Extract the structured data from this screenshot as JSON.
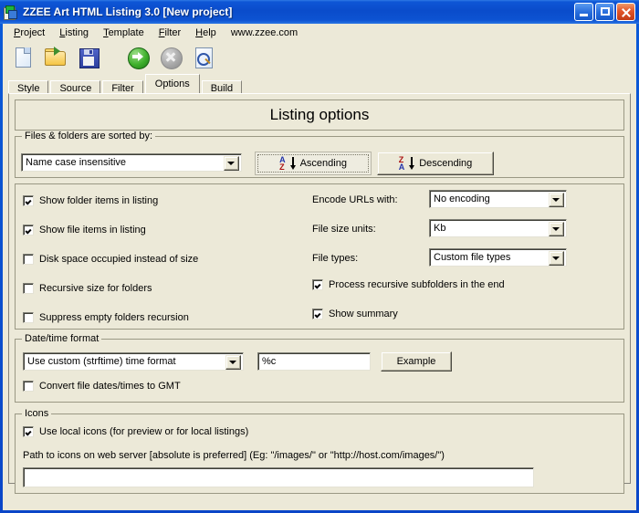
{
  "window": {
    "title": "ZZEE Art HTML Listing 3.0 [New project]",
    "icon": "app-document-icon",
    "controls": {
      "minimize": "Minimize",
      "maximize": "Maximize",
      "close": "Close"
    }
  },
  "menu": {
    "items": [
      {
        "label": "Project",
        "accel": "P"
      },
      {
        "label": "Listing",
        "accel": "L"
      },
      {
        "label": "Template",
        "accel": "T"
      },
      {
        "label": "Filter",
        "accel": "F"
      },
      {
        "label": "Help",
        "accel": "H"
      }
    ],
    "url": "www.zzee.com"
  },
  "toolbar": {
    "buttons": [
      {
        "name": "new-project-button",
        "icon": "new-document-icon",
        "enabled": true
      },
      {
        "name": "open-project-button",
        "icon": "open-folder-icon",
        "enabled": true
      },
      {
        "name": "save-project-button",
        "icon": "floppy-save-icon",
        "enabled": true
      },
      {
        "name": "build-button",
        "icon": "green-arrow-go-icon",
        "enabled": true
      },
      {
        "name": "stop-button",
        "icon": "gray-stop-icon",
        "enabled": false
      },
      {
        "name": "preview-button",
        "icon": "magnifier-preview-icon",
        "enabled": true
      }
    ]
  },
  "tabs": {
    "items": [
      "Style",
      "Source",
      "Filter",
      "Options",
      "Build"
    ],
    "active": "Options"
  },
  "page": {
    "header": "Listing options"
  },
  "sort_group": {
    "legend": "Files & folders are sorted by:",
    "combo_value": "Name case insensitive",
    "ascending_label": "Ascending",
    "descending_label": "Descending",
    "ascending_selected": true,
    "ascending_glyph": {
      "top": "A",
      "bottom": "Z"
    },
    "descending_glyph": {
      "top": "Z",
      "bottom": "A"
    }
  },
  "options": {
    "left_checkboxes": [
      {
        "label": "Show folder items in listing",
        "checked": true
      },
      {
        "label": "Show file items in listing",
        "checked": true
      },
      {
        "label": "Disk space occupied instead of size",
        "checked": false
      },
      {
        "label": "Recursive size for folders",
        "checked": false
      },
      {
        "label": "Suppress empty folders recursion",
        "checked": false
      }
    ],
    "right_fields": [
      {
        "label": "Encode URLs with:",
        "value": "No encoding"
      },
      {
        "label": "File size units:",
        "value": "Kb"
      },
      {
        "label": "File types:",
        "value": "Custom file types"
      }
    ],
    "right_checkboxes": [
      {
        "label": "Process recursive subfolders in the end",
        "checked": true
      },
      {
        "label": "Show summary",
        "checked": true
      }
    ]
  },
  "datetime_group": {
    "legend": "Date/time format",
    "combo_value": "Use custom (strftime) time format",
    "format_value": "%c",
    "format_placeholder": "",
    "example_button": "Example",
    "gmt_checkbox": {
      "label": "Convert file dates/times to GMT",
      "checked": false
    }
  },
  "icons_group": {
    "legend": "Icons",
    "local_icons_checkbox": {
      "label": "Use local icons (for preview or for local listings)",
      "checked": true
    },
    "path_label": "Path to icons on web server [absolute is preferred] (Eg: \"/images/\" or \"http://host.com/images/\")",
    "path_value": "",
    "path_placeholder": ""
  },
  "colors": {
    "window_frame": "#0a46c8",
    "face": "#ece9d8",
    "title_text": "#ffffff",
    "close_button": "#e2552a",
    "go_icon": "#3fb02c"
  }
}
